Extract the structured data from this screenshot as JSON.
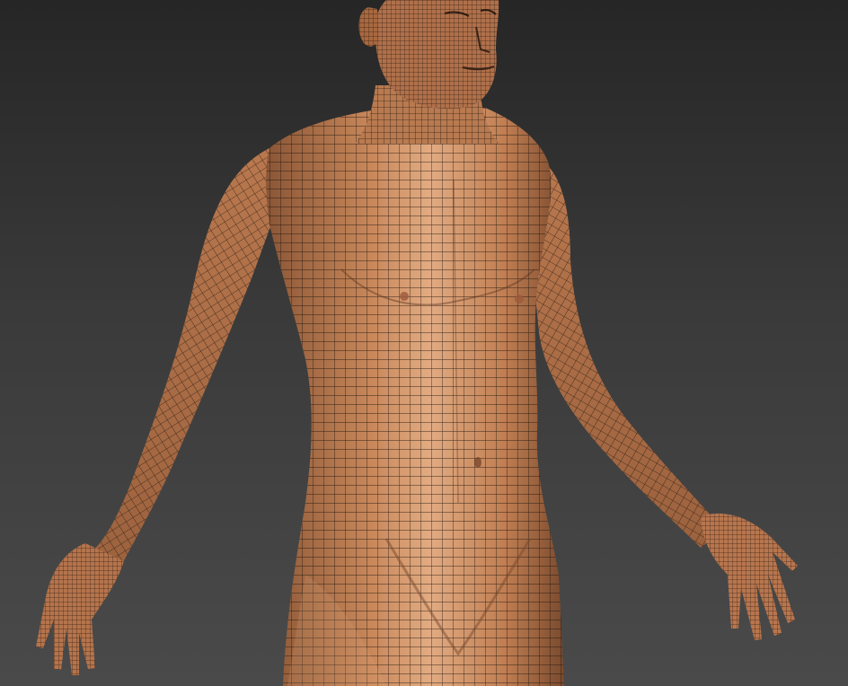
{
  "viewport": {
    "background_top": "#262626",
    "background_bottom": "#4a4a4a"
  },
  "model": {
    "skin_color": "#c8875a",
    "skin_highlight": "#e2ab82",
    "skin_shadow": "#8a5636",
    "wire_color": "#1a120c",
    "shading": "wireframe-on-shaded"
  }
}
